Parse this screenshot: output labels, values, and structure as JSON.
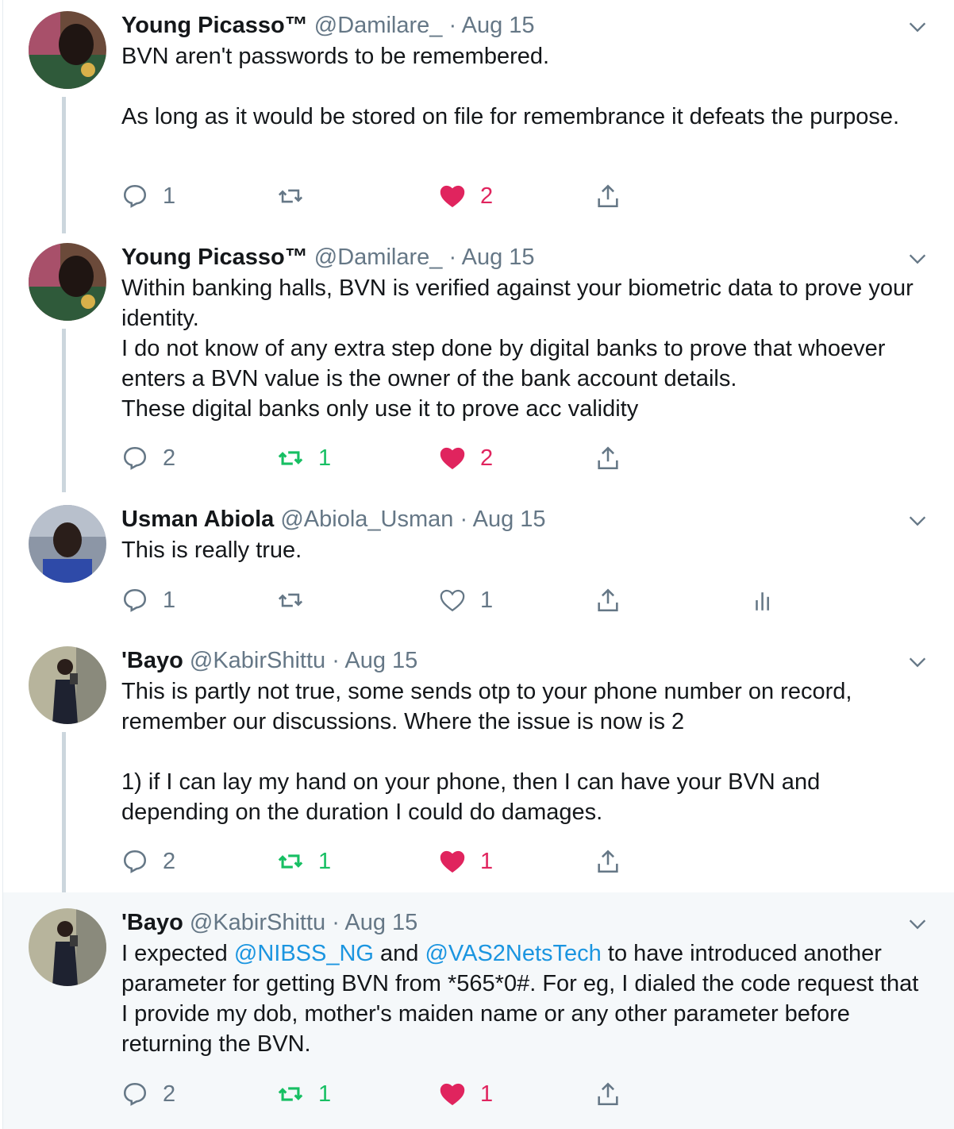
{
  "colors": {
    "accent": "#1b95e0",
    "like": "#e0245e",
    "retweet": "#17bf63",
    "muted": "#657786"
  },
  "tweets": [
    {
      "name": "Young Picasso™",
      "handle": "@Damilare_",
      "dot": "·",
      "date": "Aug 15",
      "text": "BVN aren't passwords to be remembered.\n\nAs long as it would be stored on file for remembrance it defeats the purpose.",
      "replies": "1",
      "retweets": "",
      "likes": "2",
      "liked": true,
      "retweeted": false
    },
    {
      "name": "Young Picasso™",
      "handle": "@Damilare_",
      "dot": "·",
      "date": "Aug 15",
      "text": "Within banking halls, BVN is verified against your biometric data to prove your identity.\nI do not know of any extra step done by digital banks to prove that whoever enters a BVN value is the owner of the bank account details.\nThese digital banks only use it to prove acc validity",
      "replies": "2",
      "retweets": "1",
      "likes": "2",
      "liked": true,
      "retweeted": true
    },
    {
      "name": "Usman Abiola",
      "handle": "@Abiola_Usman",
      "dot": "·",
      "date": "Aug 15",
      "text": "This is really true.",
      "replies": "1",
      "retweets": "",
      "likes": "1",
      "liked": false,
      "retweeted": false
    },
    {
      "name": "'Bayo",
      "handle": "@KabirShittu",
      "dot": "·",
      "date": "Aug 15",
      "text": "This is partly not true, some sends otp to your phone number on record, remember our discussions. Where the issue is now is 2\n\n1) if I can lay my hand on your phone, then I can have your BVN and depending on the duration I could do damages.",
      "replies": "2",
      "retweets": "1",
      "likes": "1",
      "liked": true,
      "retweeted": true
    },
    {
      "name": "'Bayo",
      "handle": "@KabirShittu",
      "dot": "·",
      "date": "Aug 15",
      "text_before": "I expected ",
      "mention1": "@NIBSS_NG",
      "text_mid": " and ",
      "mention2": "@VAS2NetsTech",
      "text_after": " to have introduced another parameter for getting BVN from *565*0#. For eg, I dialed the code request that I provide my dob, mother's maiden name or any other parameter before returning the BVN.",
      "replies": "2",
      "retweets": "1",
      "likes": "1",
      "liked": true,
      "retweeted": true
    }
  ]
}
